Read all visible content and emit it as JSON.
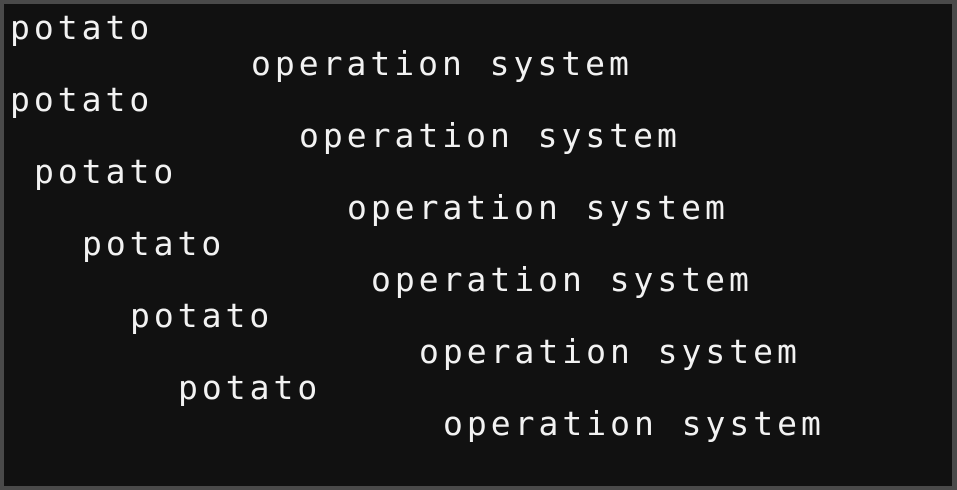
{
  "terminal": {
    "lines": [
      {
        "word_a": "potato",
        "word_b": "operation system"
      },
      {
        "word_a": "potato",
        "word_b": "operation system"
      },
      {
        "word_a": "potato",
        "word_b": "operation system"
      },
      {
        "word_a": "potato",
        "word_b": "operation system"
      },
      {
        "word_a": "potato",
        "word_b": "operation system"
      },
      {
        "word_a": "potato",
        "word_b": "operation system"
      }
    ]
  },
  "colors": {
    "background": "#111111",
    "text": "#f2f2f2",
    "border": "#4a4a4a"
  }
}
